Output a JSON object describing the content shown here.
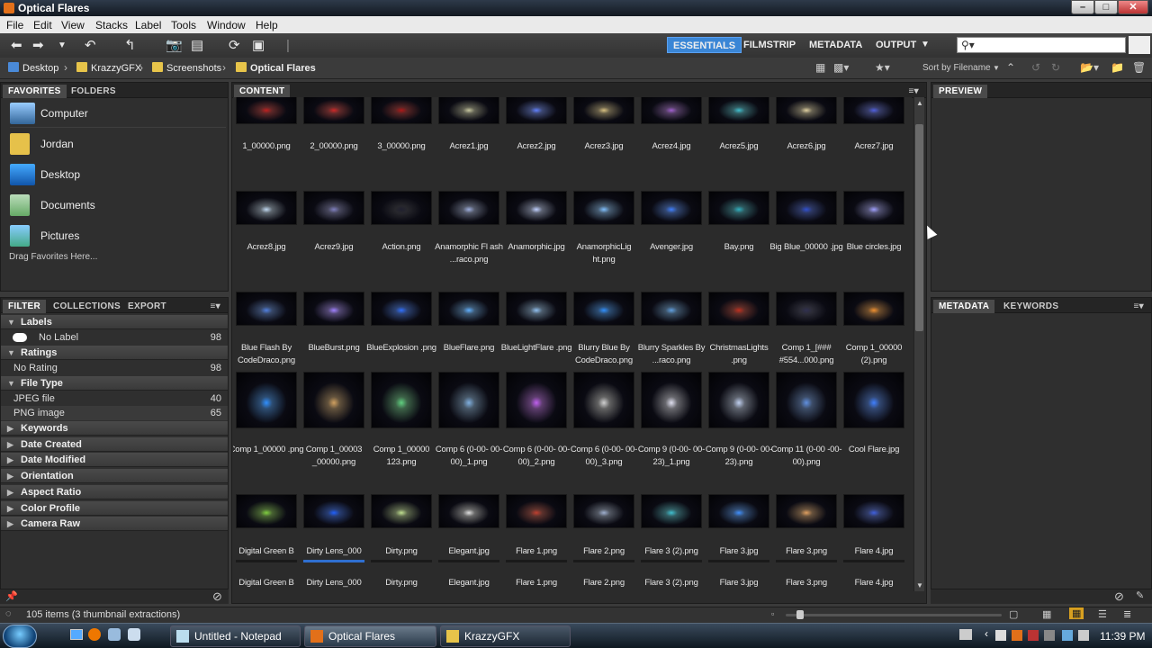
{
  "window": {
    "title": "Optical Flares"
  },
  "menu": [
    "File",
    "Edit",
    "View",
    "Stacks",
    "Label",
    "Tools",
    "Window",
    "Help"
  ],
  "workspaces": [
    {
      "label": "ESSENTIALS",
      "active": true
    },
    {
      "label": "FILMSTRIP",
      "active": false
    },
    {
      "label": "METADATA",
      "active": false
    },
    {
      "label": "OUTPUT",
      "active": false
    }
  ],
  "search": {
    "placeholder": "⚲▾"
  },
  "breadcrumb": [
    "Desktop",
    "KrazzyGFX",
    "Screenshots",
    "Optical Flares"
  ],
  "sort": {
    "label": "Sort by Filename"
  },
  "left_panel": {
    "tabs": [
      "FAVORITES",
      "FOLDERS"
    ],
    "favorites": [
      "Computer",
      "Jordan",
      "Desktop",
      "Documents",
      "Pictures"
    ],
    "drag_hint": "Drag Favorites Here..."
  },
  "filter_panel": {
    "tabs": [
      "FILTER",
      "COLLECTIONS",
      "EXPORT"
    ],
    "sections": [
      {
        "title": "Labels",
        "open": true,
        "rows": [
          {
            "label": "No Label",
            "count": "98"
          }
        ]
      },
      {
        "title": "Ratings",
        "open": true,
        "rows": [
          {
            "label": "No Rating",
            "count": "98"
          }
        ]
      },
      {
        "title": "File Type",
        "open": true,
        "rows": [
          {
            "label": "JPEG file",
            "count": "40"
          },
          {
            "label": "PNG image",
            "count": "65"
          }
        ]
      },
      {
        "title": "Keywords",
        "open": false,
        "rows": []
      },
      {
        "title": "Date Created",
        "open": false,
        "rows": []
      },
      {
        "title": "Date Modified",
        "open": false,
        "rows": []
      },
      {
        "title": "Orientation",
        "open": false,
        "rows": []
      },
      {
        "title": "Aspect Ratio",
        "open": false,
        "rows": []
      },
      {
        "title": "Color Profile",
        "open": false,
        "rows": []
      },
      {
        "title": "Camera Raw",
        "open": false,
        "rows": []
      }
    ]
  },
  "content": {
    "tab": "CONTENT",
    "items": [
      {
        "name": "1_00000.png",
        "color": "#c02020"
      },
      {
        "name": "2_00000.png",
        "color": "#d02828"
      },
      {
        "name": "3_00000.png",
        "color": "#b01818"
      },
      {
        "name": "Acrez1.jpg",
        "color": "#c8c8a0"
      },
      {
        "name": "Acrez2.jpg",
        "color": "#6080ff"
      },
      {
        "name": "Acrez3.jpg",
        "color": "#d8c080"
      },
      {
        "name": "Acrez4.jpg",
        "color": "#a060d0"
      },
      {
        "name": "Acrez5.jpg",
        "color": "#40c0d0"
      },
      {
        "name": "Acrez6.jpg",
        "color": "#e0d0a0"
      },
      {
        "name": "Acrez7.jpg",
        "color": "#5060e0"
      },
      {
        "name": "Acrez8.jpg",
        "color": "#c0d8f0"
      },
      {
        "name": "Acrez9.jpg",
        "color": "#8080c0"
      },
      {
        "name": "Action.png",
        "color": "#202030"
      },
      {
        "name": "Anamorphic Fl ash ...raco.png",
        "color": "#a0b0e0"
      },
      {
        "name": "Anamorphic.jpg",
        "color": "#c0d0ff"
      },
      {
        "name": "AnamorphicLig ht.png",
        "color": "#80c0ff"
      },
      {
        "name": "Avenger.jpg",
        "color": "#4080ff"
      },
      {
        "name": "Bay.png",
        "color": "#30b0c0"
      },
      {
        "name": "Big Blue_00000 .jpg",
        "color": "#3050d0"
      },
      {
        "name": "Blue circles.jpg",
        "color": "#a0a0ff"
      },
      {
        "name": "Blue Flash By CodeDraco.png",
        "color": "#5080e0"
      },
      {
        "name": "BlueBurst.png",
        "color": "#a080ff"
      },
      {
        "name": "BlueExplosion .png",
        "color": "#3070ff"
      },
      {
        "name": "BlueFlare.png",
        "color": "#60b0ff"
      },
      {
        "name": "BlueLightFlare .png",
        "color": "#90c0f0"
      },
      {
        "name": "Blurry Blue By CodeDraco.png",
        "color": "#3090ff"
      },
      {
        "name": "Blurry Sparkles By ...raco.png",
        "color": "#60a0e0"
      },
      {
        "name": "ChristmasLights .png",
        "color": "#c03020"
      },
      {
        "name": "Comp 1_[### #554...000.png",
        "color": "#303050"
      },
      {
        "name": "Comp 1_00000 (2).png",
        "color": "#f09030"
      },
      {
        "name": "Comp 1_00000 .png",
        "color": "#3090ff"
      },
      {
        "name": "Comp 1_00003 _00000.png",
        "color": "#d0a060"
      },
      {
        "name": "Comp 1_00000 123.png",
        "color": "#60d080"
      },
      {
        "name": "Comp 6 (0-00- 00-00)_1.png",
        "color": "#80b0e0"
      },
      {
        "name": "Comp 6 (0-00- 00-00)_2.png",
        "color": "#c060f0"
      },
      {
        "name": "Comp 6 (0-00- 00-00)_3.png",
        "color": "#d0d0d0"
      },
      {
        "name": "Comp 9 (0-00- 00-23)_1.png",
        "color": "#e0e0f0"
      },
      {
        "name": "Comp 9 (0-00- 00-23).png",
        "color": "#c0d0f0"
      },
      {
        "name": "Comp 11 (0-00 -00-00).png",
        "color": "#6090e0"
      },
      {
        "name": "Cool Flare.jpg",
        "color": "#4080ff"
      },
      {
        "name": "Digital Green B",
        "color": "#80d040"
      },
      {
        "name": "Dirty Lens_000",
        "color": "#2060ff"
      },
      {
        "name": "Dirty.png",
        "color": "#c0e090"
      },
      {
        "name": "Elegant.jpg",
        "color": "#e0e0e0"
      },
      {
        "name": "Flare 1.png",
        "color": "#c04030"
      },
      {
        "name": "Flare 2.png",
        "color": "#a0b0d0"
      },
      {
        "name": "Flare 3 (2).png",
        "color": "#40c0d0"
      },
      {
        "name": "Flare 3.jpg",
        "color": "#4090ff"
      },
      {
        "name": "Flare 3.png",
        "color": "#e0a060"
      },
      {
        "name": "Flare 4.jpg",
        "color": "#4060e0"
      }
    ],
    "partial_row": [
      "Digital Green B",
      "Dirty Lens_000",
      "Dirty.png",
      "Elegant.jpg",
      "Flare 1.png",
      "Flare 2.png",
      "Flare 3 (2).png",
      "Flare 3.jpg",
      "Flare 3.png",
      "Flare 4.jpg"
    ]
  },
  "preview_panel": {
    "tab": "PREVIEW"
  },
  "metadata_panel": {
    "tabs": [
      "METADATA",
      "KEYWORDS"
    ]
  },
  "status": {
    "text": "105 items (3 thumbnail extractions)"
  },
  "taskbar": {
    "tasks": [
      "Untitled - Notepad",
      "Optical Flares",
      "KrazzyGFX"
    ],
    "clock": "11:39 PM"
  }
}
